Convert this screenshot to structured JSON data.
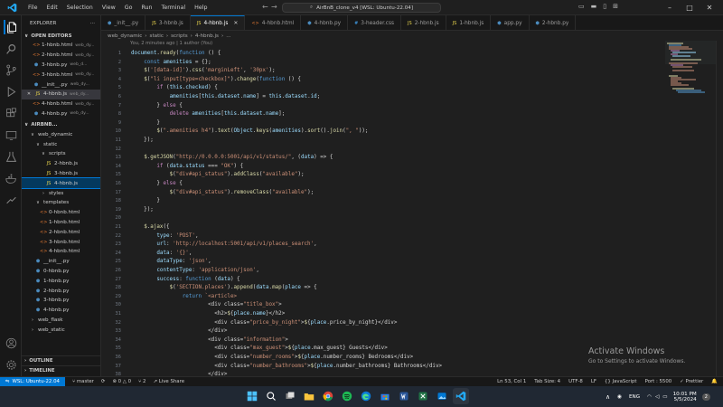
{
  "window": {
    "search_title": "AirBnB_clone_v4 [WSL: Ubuntu-22.04]",
    "menu": [
      "File",
      "Edit",
      "Selection",
      "View",
      "Go",
      "Run",
      "Terminal",
      "Help"
    ]
  },
  "sidebar": {
    "title": "EXPLORER",
    "more": "···",
    "open_editors_header": "OPEN EDITORS",
    "open_editors": [
      {
        "name": "1-hbnb.html",
        "sub": "web_dy...",
        "icon": "<>",
        "type": "html",
        "close": false,
        "selected": false
      },
      {
        "name": "2-hbnb.html",
        "sub": "web_dy...",
        "icon": "<>",
        "type": "html",
        "close": false,
        "selected": false
      },
      {
        "name": "3-hbnb.py",
        "sub": "web_d...",
        "icon": "⬢",
        "type": "py",
        "close": false,
        "selected": false
      },
      {
        "name": "3-hbnb.html",
        "sub": "web_dy...",
        "icon": "<>",
        "type": "html",
        "close": false,
        "selected": false
      },
      {
        "name": "__init__.py",
        "sub": "web_dy...",
        "icon": "⬢",
        "type": "py",
        "close": false,
        "selected": false
      },
      {
        "name": "4-hbnb.js",
        "sub": "web_dy...",
        "icon": "JS",
        "type": "js",
        "close": true,
        "selected": true
      },
      {
        "name": "4-hbnb.html",
        "sub": "web_dy...",
        "icon": "<>",
        "type": "html",
        "close": false,
        "selected": false
      },
      {
        "name": "4-hbnb.py",
        "sub": "web_dy...",
        "icon": "⬢",
        "type": "py",
        "close": false,
        "selected": false
      }
    ],
    "project_header": "AIRBNB...",
    "tree": [
      {
        "name": "web_dynamic",
        "indent": 1,
        "chev": "∨",
        "icon": "",
        "type": "",
        "cls": ""
      },
      {
        "name": "static",
        "indent": 2,
        "chev": "∨",
        "icon": "",
        "type": "",
        "cls": ""
      },
      {
        "name": "scripts",
        "indent": 3,
        "chev": "∨",
        "icon": "",
        "type": "",
        "cls": ""
      },
      {
        "name": "2-hbnb.js",
        "indent": 4,
        "chev": "",
        "icon": "JS",
        "type": "js",
        "cls": ""
      },
      {
        "name": "3-hbnb.js",
        "indent": 4,
        "chev": "",
        "icon": "JS",
        "type": "js",
        "cls": ""
      },
      {
        "name": "4-hbnb.js",
        "indent": 4,
        "chev": "",
        "icon": "JS",
        "type": "js",
        "cls": "act2"
      },
      {
        "name": "styles",
        "indent": 3,
        "chev": "›",
        "icon": "",
        "type": "",
        "cls": ""
      },
      {
        "name": "templates",
        "indent": 2,
        "chev": "∨",
        "icon": "",
        "type": "",
        "cls": ""
      },
      {
        "name": "0-hbnb.html",
        "indent": 3,
        "chev": "",
        "icon": "<>",
        "type": "html",
        "cls": ""
      },
      {
        "name": "1-hbnb.html",
        "indent": 3,
        "chev": "",
        "icon": "<>",
        "type": "html",
        "cls": ""
      },
      {
        "name": "2-hbnb.html",
        "indent": 3,
        "chev": "",
        "icon": "<>",
        "type": "html",
        "cls": ""
      },
      {
        "name": "3-hbnb.html",
        "indent": 3,
        "chev": "",
        "icon": "<>",
        "type": "html",
        "cls": ""
      },
      {
        "name": "4-hbnb.html",
        "indent": 3,
        "chev": "",
        "icon": "<>",
        "type": "html",
        "cls": ""
      },
      {
        "name": "__init__.py",
        "indent": 2,
        "chev": "",
        "icon": "⬢",
        "type": "py",
        "cls": ""
      },
      {
        "name": "0-hbnb.py",
        "indent": 2,
        "chev": "",
        "icon": "⬢",
        "type": "py",
        "cls": ""
      },
      {
        "name": "1-hbnb.py",
        "indent": 2,
        "chev": "",
        "icon": "⬢",
        "type": "py",
        "cls": ""
      },
      {
        "name": "2-hbnb.py",
        "indent": 2,
        "chev": "",
        "icon": "⬢",
        "type": "py",
        "cls": ""
      },
      {
        "name": "3-hbnb.py",
        "indent": 2,
        "chev": "",
        "icon": "⬢",
        "type": "py",
        "cls": ""
      },
      {
        "name": "4-hbnb.py",
        "indent": 2,
        "chev": "",
        "icon": "⬢",
        "type": "py",
        "cls": ""
      },
      {
        "name": "web_flask",
        "indent": 1,
        "chev": "›",
        "icon": "",
        "type": "",
        "cls": ""
      },
      {
        "name": "web_static",
        "indent": 1,
        "chev": "›",
        "icon": "",
        "type": "",
        "cls": ""
      }
    ],
    "outline_header": "OUTLINE",
    "timeline_header": "TIMELINE"
  },
  "tabs": [
    {
      "label": "_init__.py",
      "icon": "⬢",
      "type": "py",
      "active": false
    },
    {
      "label": "3-hbnb.js",
      "icon": "JS",
      "type": "js",
      "active": false
    },
    {
      "label": "4-hbnb.js",
      "icon": "JS",
      "type": "js",
      "active": true
    },
    {
      "label": "4-hbnb.html",
      "icon": "<>",
      "type": "html",
      "active": false
    },
    {
      "label": "4-hbnb.py",
      "icon": "⬢",
      "type": "py",
      "active": false
    },
    {
      "label": "3-header.css",
      "icon": "#",
      "type": "css",
      "active": false
    },
    {
      "label": "2-hbnb.js",
      "icon": "JS",
      "type": "js",
      "active": false
    },
    {
      "label": "1-hbnb.js",
      "icon": "JS",
      "type": "js",
      "active": false
    },
    {
      "label": "app.py",
      "icon": "⬢",
      "type": "py",
      "active": false
    },
    {
      "label": "2-hbnb.py",
      "icon": "⬢",
      "type": "py",
      "active": false
    }
  ],
  "breadcrumb": [
    "web_dynamic",
    "static",
    "scripts",
    "4-hbnb.js",
    "..."
  ],
  "editor": {
    "blame": "You, 2 minutes ago | 1 author (You)",
    "lines": [
      {
        "n": "1",
        "t": "document.ready(function () {"
      },
      {
        "n": "2",
        "t": "    const amenities = {};"
      },
      {
        "n": "3",
        "t": "    $('[data-id]').css('marginLeft', '30px');"
      },
      {
        "n": "4",
        "t": "    $(\"li input[type=checkbox]\").change(function () {"
      },
      {
        "n": "5",
        "t": "        if (this.checked) {"
      },
      {
        "n": "6",
        "t": "            amenities[this.dataset.name] = this.dataset.id;"
      },
      {
        "n": "7",
        "t": "        } else {"
      },
      {
        "n": "8",
        "t": "            delete amenities[this.dataset.name];"
      },
      {
        "n": "9",
        "t": "        }"
      },
      {
        "n": "10",
        "t": "        $(\".amenities h4\").text(Object.keys(amenities).sort().join(\", \"));"
      },
      {
        "n": "11",
        "t": "    });"
      },
      {
        "n": "12",
        "t": ""
      },
      {
        "n": "13",
        "t": "    $.getJSON(\"http://0.0.0.0:5001/api/v1/status/\", (data) => {"
      },
      {
        "n": "14",
        "t": "        if (data.status === \"OK\") {"
      },
      {
        "n": "15",
        "t": "            $(\"div#api_status\").addClass(\"available\");"
      },
      {
        "n": "16",
        "t": "        } else {"
      },
      {
        "n": "17",
        "t": "            $(\"div#api_status\").removeClass(\"available\");"
      },
      {
        "n": "18",
        "t": "        }"
      },
      {
        "n": "19",
        "t": "    });"
      },
      {
        "n": "20",
        "t": ""
      },
      {
        "n": "21",
        "t": "    $.ajax({"
      },
      {
        "n": "22",
        "t": "        type: 'POST',"
      },
      {
        "n": "23",
        "t": "        url: 'http://localhost:5001/api/v1/places_search',"
      },
      {
        "n": "24",
        "t": "        data: '{}',"
      },
      {
        "n": "25",
        "t": "        dataType: 'json',"
      },
      {
        "n": "26",
        "t": "        contentType: 'application/json',"
      },
      {
        "n": "27",
        "t": "        success: function (data) {"
      },
      {
        "n": "28",
        "t": "            $('SECTION.places').append(data.map(place => {"
      },
      {
        "n": "29",
        "t": "                return `<article>"
      },
      {
        "n": "30",
        "t": "                        <div class=\"title_box\">"
      },
      {
        "n": "31",
        "t": "                          <h2>${place.name}</h2>"
      },
      {
        "n": "32",
        "t": "                          <div class=\"price_by_night\">${place.price_by_night}</div>"
      },
      {
        "n": "33",
        "t": "                        </div>"
      },
      {
        "n": "34",
        "t": "                        <div class=\"information\">"
      },
      {
        "n": "35",
        "t": "                          <div class=\"max_guest\">${place.max_guest} Guests</div>"
      },
      {
        "n": "36",
        "t": "                          <div class=\"number_rooms\">${place.number_rooms} Bedrooms</div>"
      },
      {
        "n": "37",
        "t": "                          <div class=\"number_bathrooms\">${place.number_bathrooms} Bathrooms</div>"
      },
      {
        "n": "38",
        "t": "                        </div>"
      }
    ]
  },
  "watermark": {
    "title": "Activate Windows",
    "subtitle": "Go to Settings to activate Windows."
  },
  "status": {
    "remote": "WSL: Ubuntu-22.04",
    "branch": "master",
    "sync": "⟳",
    "problems": "⊗ 0 △ 0",
    "ports": "⑂ 2",
    "live": "Live Share",
    "right": [
      "Ln 53, Col 1",
      "Tab Size: 4",
      "UTF-8",
      "LF",
      "{} JavaScript",
      "Port : 5500",
      "✓ Prettier",
      "🔔"
    ]
  },
  "taskbar": {
    "lang": "ENG",
    "time": "10:01 PM",
    "date": "5/5/2024",
    "badge": "2"
  },
  "colors": {
    "accent": "#0078d4",
    "keyword": "#569cd6",
    "control": "#c586c0",
    "string": "#ce9178",
    "function": "#dcdcaa",
    "variable": "#9cdcfe",
    "tag": "#569cd6"
  }
}
